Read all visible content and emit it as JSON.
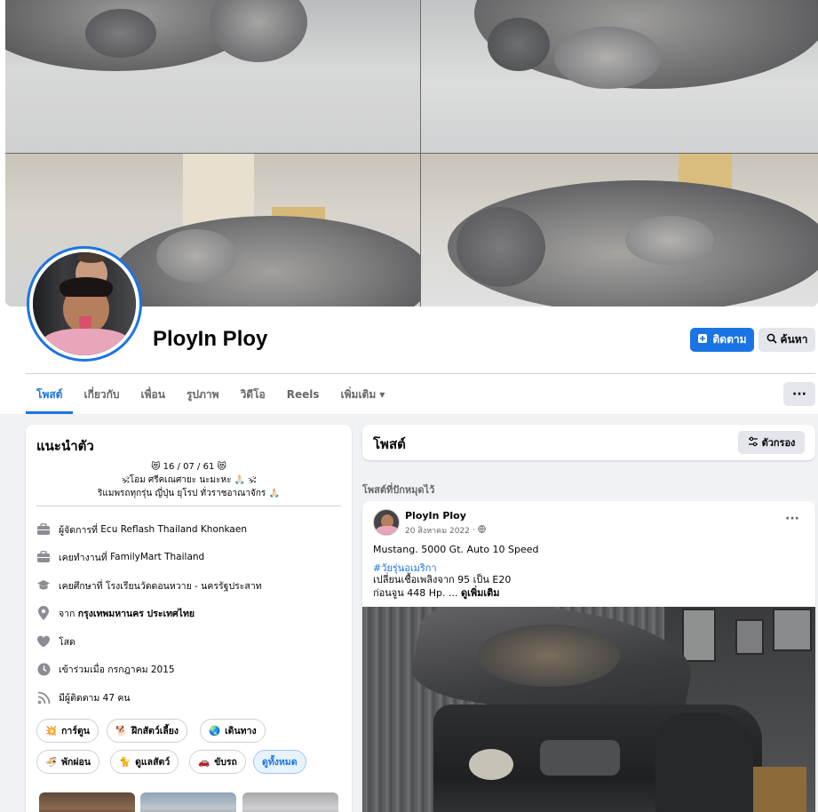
{
  "profile": {
    "name": "PloyIn Ploy"
  },
  "actions": {
    "follow_label": "ติดตาม",
    "search_label": "ค้นหา",
    "more_label": "···"
  },
  "tabs": [
    {
      "label": "โพสต์",
      "active": true
    },
    {
      "label": "เกี่ยวกับ",
      "active": false
    },
    {
      "label": "เพื่อน",
      "active": false
    },
    {
      "label": "รูปภาพ",
      "active": false
    },
    {
      "label": "วิดีโอ",
      "active": false
    },
    {
      "label": "Reels",
      "active": false
    },
    {
      "label": "เพิ่มเติม",
      "active": false
    }
  ],
  "intro": {
    "title": "แนะนำตัว",
    "bio_lines": [
      "😻 16 / 07 / 61 😻",
      "🕉โอม ศรีคเณศายะ นะมะหะ 🙏🏻 🕉",
      "ริแมพรถทุกรุ่น ญี่ปุ่น ยุโรป ทั่วราชอาณาจักร 🙏🏻"
    ],
    "details": [
      {
        "icon": "briefcase-icon",
        "prefix": "ผู้จัดการที่",
        "value": "Ecu Reflash Thailand Khonkaen"
      },
      {
        "icon": "briefcase-icon",
        "prefix": "เคยทำงานที่",
        "value": "FamilyMart Thailand"
      },
      {
        "icon": "graduation-cap-icon",
        "prefix": "เคยศึกษาที่",
        "value": "โรงเรียนวัดดอนหวาย - นครรัฐประสาท"
      },
      {
        "icon": "location-pin-icon",
        "prefix": "จาก",
        "value": "กรุงเทพมหานคร ประเทศไทย"
      },
      {
        "icon": "heart-icon",
        "prefix": "",
        "value": "โสด"
      },
      {
        "icon": "clock-icon",
        "prefix": "",
        "value": "เข้าร่วมเมื่อ กรกฎาคม 2015"
      },
      {
        "icon": "rss-icon",
        "prefix": "",
        "value": "มีผู้ติดตาม 47 คน"
      }
    ],
    "hobbies": [
      {
        "emoji": "💥",
        "label": "การ์ตูน"
      },
      {
        "emoji": "🐕",
        "label": "ฝึกสัตว์เลี้ยง"
      },
      {
        "emoji": "🌏",
        "label": "เดินทาง"
      },
      {
        "emoji": "🍜",
        "label": "พักผ่อน"
      },
      {
        "emoji": "🐈",
        "label": "ดูแลสัตว์"
      },
      {
        "emoji": "🚗",
        "label": "ขับรถ"
      }
    ],
    "see_all_label": "ดูทั้งหมด"
  },
  "posts": {
    "title": "โพสต์",
    "filter_label": "ตัวกรอง",
    "pinned_label": "โพสต์ที่ปักหมุดไว้"
  },
  "post": {
    "author": "PloyIn Ploy",
    "date": "20 สิงหาคม 2022",
    "privacy_icon": "globe-icon",
    "line1": "Mustang. 5000 Gt. Auto 10 Speed",
    "hashtag": "#วัยรุ่นอเมริกา",
    "line2": "เปลี่ยนเชื้อเพลิงจาก 95 เป็น E20",
    "line3": "ก่อนจูน  448  Hp. ...",
    "see_more": "ดูเพิ่มเติม"
  },
  "colors": {
    "accent": "#1b74e4",
    "background": "#f0f2f5",
    "card": "#ffffff",
    "secondary_text": "#65676b"
  }
}
